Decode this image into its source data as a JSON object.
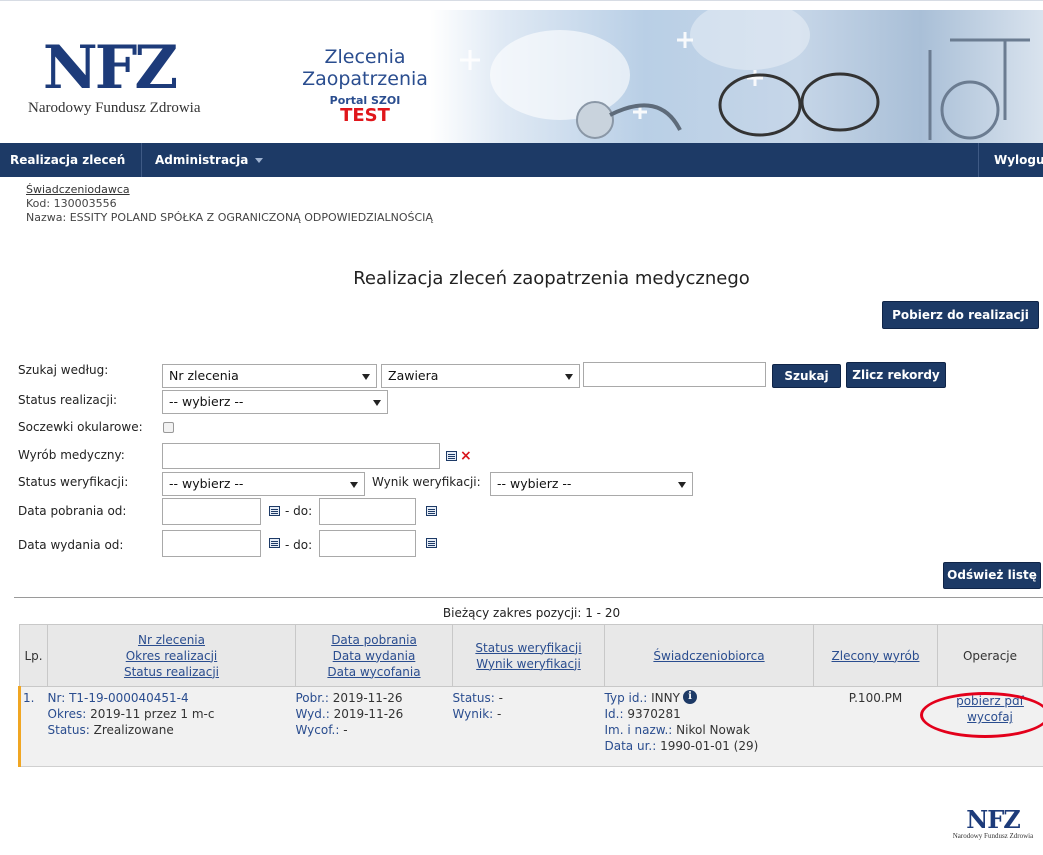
{
  "header": {
    "logo_text": "NFZ",
    "logo_sub": "Narodowy Fundusz Zdrowia",
    "app_title_line1": "Zlecenia",
    "app_title_line2": "Zaopatrzenia",
    "portal": "Portal SZOI",
    "env": "TEST"
  },
  "nav": {
    "item1": "Realizacja zleceń",
    "item2": "Administracja",
    "logout": "Wyloguj"
  },
  "provider": {
    "link": "Świadczeniodawca",
    "kod_label": "Kod:",
    "kod_value": "130003556",
    "nazwa_label": "Nazwa:",
    "nazwa_value": "ESSITY POLAND SPÓŁKA Z OGRANICZONĄ ODPOWIEDZIALNOŚCIĄ"
  },
  "page_title": "Realizacja zleceń zaopatrzenia medycznego",
  "buttons": {
    "pobierz": "Pobierz do realizacji",
    "szukaj": "Szukaj",
    "zlicz": "Zlicz rekordy",
    "odswiez": "Odśwież listę"
  },
  "form": {
    "szukaj_label": "Szukaj według:",
    "szukaj_field": "Nr zlecenia",
    "szukaj_op": "Zawiera",
    "status_label": "Status realizacji:",
    "status_value": "-- wybierz --",
    "soczewki_label": "Soczewki okularowe:",
    "wyrob_label": "Wyrób medyczny:",
    "weryf_label": "Status weryfikacji:",
    "weryf_value": "-- wybierz --",
    "wynik_label": "Wynik weryfikacji:",
    "wynik_value": "-- wybierz --",
    "pobrania_label": "Data pobrania od:",
    "wydania_label": "Data wydania od:",
    "do_label": "- do:"
  },
  "range_text": "Bieżący zakres pozycji: 1 - 20",
  "table": {
    "headers": {
      "lp": "Lp.",
      "c1a": "Nr zlecenia",
      "c1b": "Okres realizacji",
      "c1c": "Status realizacji",
      "c2a": "Data pobrania",
      "c2b": "Data wydania",
      "c2c": "Data wycofania",
      "c3a": "Status weryfikacji",
      "c3b": "Wynik weryfikacji",
      "c4": "Świadczeniobiorca",
      "c5": "Zlecony wyrób",
      "c6": "Operacje"
    },
    "row": {
      "lp": "1.",
      "nr_label": "Nr:",
      "nr_value": "T1-19-000040451-4",
      "okres_label": "Okres:",
      "okres_value": "2019-11 przez 1 m-c",
      "status_label": "Status:",
      "status_value": "Zrealizowane",
      "pobr_label": "Pobr.:",
      "pobr_value": "2019-11-26",
      "wyd_label": "Wyd.:",
      "wyd_value": "2019-11-26",
      "wycof_label": "Wycof.:",
      "wycof_value": "-",
      "sw_label": "Status:",
      "sw_value": "-",
      "wyn_label": "Wynik:",
      "wyn_value": "-",
      "typ_label": "Typ id.:",
      "typ_value": "INNY",
      "id_label": "Id.:",
      "id_value": "9370281",
      "imie_label": "Im. i nazw.:",
      "imie_value": "Nikol Nowak",
      "dataur_label": "Data ur.:",
      "dataur_value": "1990-01-01 (29)",
      "wyrob": "P.100.PM",
      "op1": "pobierz pdf",
      "op2": "wycofaj"
    }
  },
  "footer": {
    "logo_text": "NFZ",
    "logo_sub": "Narodowy Fundusz Zdrowia"
  },
  "colors": {
    "navy": "#1d3a66",
    "link": "#2a4d8f",
    "test_red": "#e0161b",
    "row_accent": "#f0a623"
  }
}
